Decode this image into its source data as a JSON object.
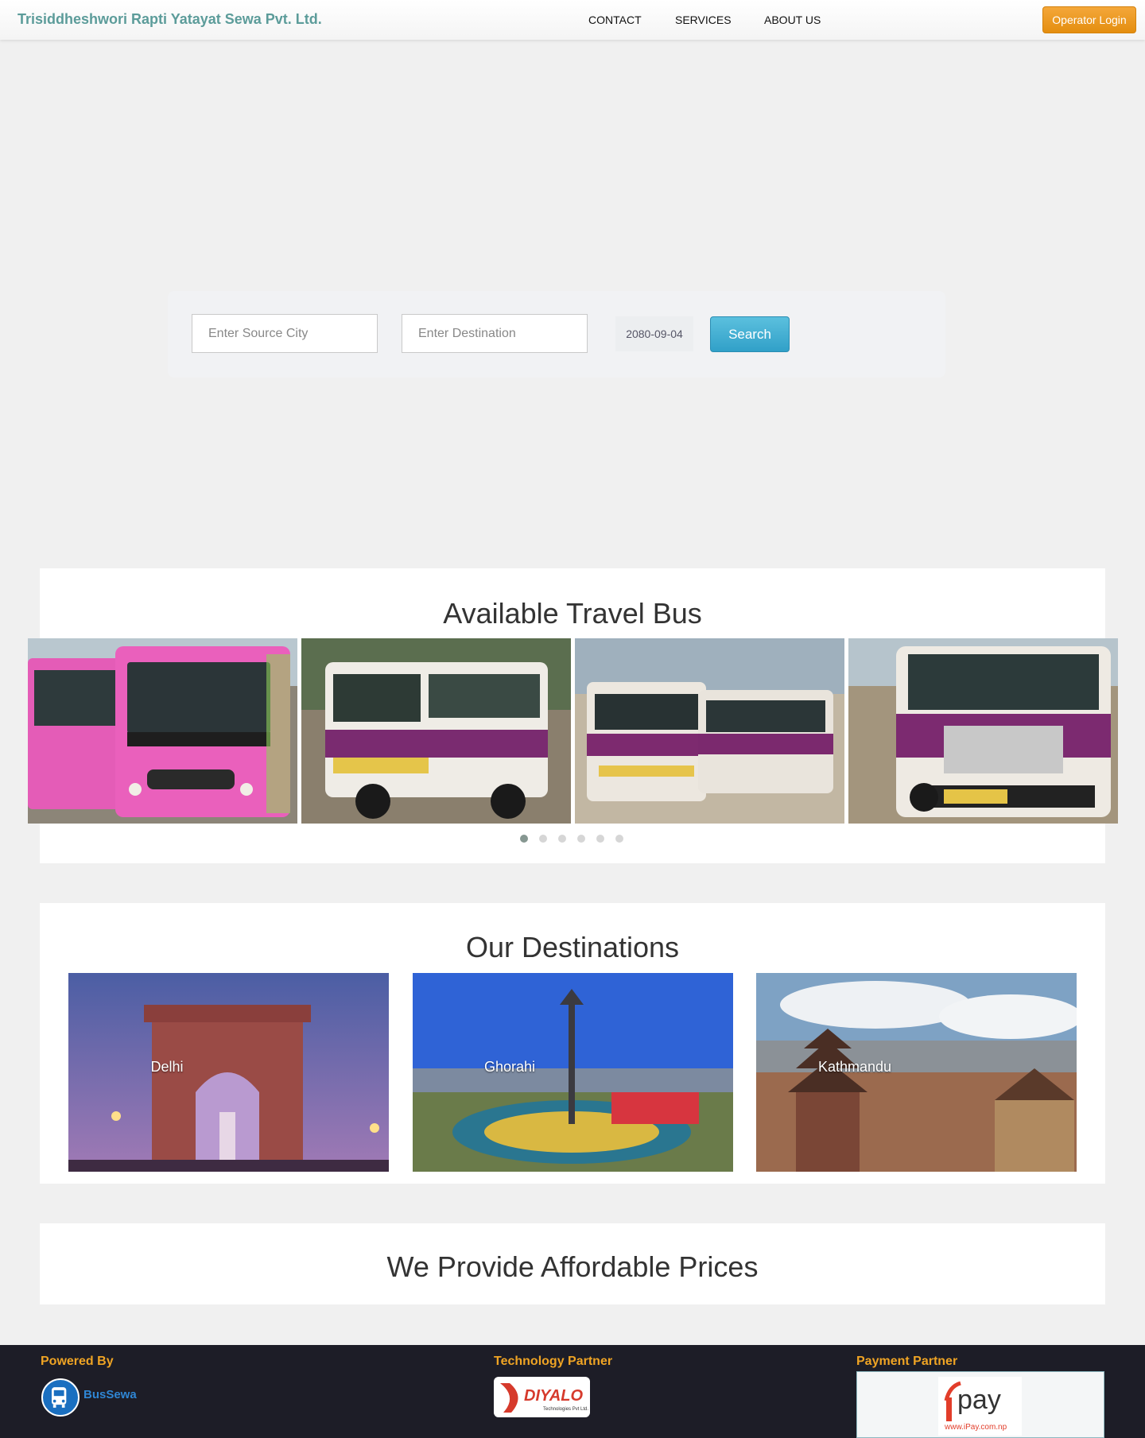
{
  "header": {
    "brand": "Trisiddheshwori Rapti Yatayat Sewa Pvt. Ltd.",
    "nav": [
      "CONTACT",
      "SERVICES",
      "ABOUT US"
    ],
    "operator_login": "Operator Login"
  },
  "search": {
    "source_placeholder": "Enter Source City",
    "destination_placeholder": "Enter Destination",
    "date": "2080-09-04",
    "button": "Search"
  },
  "buses": {
    "title": "Available Travel Bus",
    "slide_count": 6,
    "active_slide": 1
  },
  "destinations": {
    "title": "Our Destinations",
    "items": [
      "Delhi",
      "Ghorahi",
      "Kathmandu"
    ]
  },
  "prices": {
    "title": "We Provide Affordable Prices"
  },
  "footer": {
    "powered_by": "Powered By",
    "powered_name": "BusSewa",
    "tech_partner": "Technology Partner",
    "tech_logo_text": "DIYALO",
    "payment_partner": "Payment Partner",
    "payment_logo_text": "pay",
    "payment_logo_url": "www.iPay.com.np"
  },
  "colors": {
    "brand": "#5c9c9a",
    "operator_button": "#ec9a1e",
    "search_button": "#4ab3d8",
    "footer_bg": "#1d1d27",
    "footer_heading": "#efa424",
    "bus_pink": "#e458b7",
    "bus_purple": "#7e2a72"
  }
}
